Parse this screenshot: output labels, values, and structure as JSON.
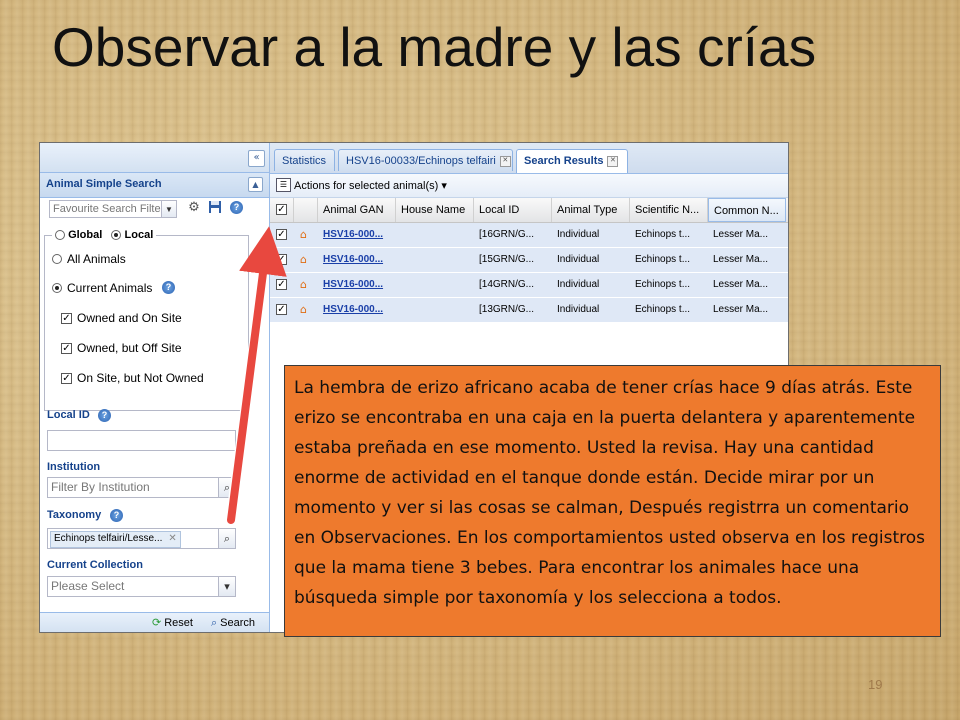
{
  "slide": {
    "title": "Observar a la madre y las crías",
    "page_number": "19",
    "callout_text": "La hembra de erizo africano acaba de tener crías hace 9 días atrás. Este erizo se encontraba en una caja en la puerta delantera y aparentemente estaba preñada en ese momento. Usted la revisa. Hay una cantidad enorme de actividad en el tanque donde están. Decide mirar por un momento y ver si las cosas se calman, Después registrra un comentario en Observaciones. En los comportamientos usted observa en los registros que la mama tiene 3 bebes. Para encontrar los animales hace una búsqueda simple por taxonomía y los selecciona a todos.",
    "colors": {
      "callout_bg": "#ee7a2d",
      "arrow": "#e8483f",
      "panel_header_text": "#15428b"
    }
  },
  "left_panel": {
    "collapse_icon": "double-chevron-left-icon",
    "header_title": "Animal Simple Search",
    "favourite_placeholder": "Favourite Search Filte",
    "scope": {
      "global_label": "Global",
      "local_label": "Local",
      "selected": "Local"
    },
    "options": {
      "all_animals": "All Animals",
      "current_animals": "Current Animals",
      "owned_on_site": "Owned and On Site",
      "owned_off_site": "Owned, but Off Site",
      "on_site_not_owned": "On Site, but Not Owned"
    },
    "local_id_label": "Local ID",
    "institution_label": "Institution",
    "institution_placeholder": "Filter By Institution",
    "taxonomy_label": "Taxonomy",
    "taxonomy_tag": "Echinops telfairi/Lesse...",
    "current_collection_label": "Current Collection",
    "current_collection_value": "Please Select",
    "reset_label": "Reset",
    "search_label": "Search"
  },
  "tabs": [
    {
      "label": "Statistics"
    },
    {
      "label": "HSV16-00033/Echinops telfairi"
    },
    {
      "label": "Search Results"
    }
  ],
  "toolbar": {
    "actions_label": "Actions for selected animal(s)"
  },
  "grid": {
    "columns": [
      "Animal GAN",
      "House Name",
      "Local ID",
      "Animal Type",
      "Scientific N...",
      "Common N..."
    ],
    "rows": [
      {
        "gan": "HSV16-000...",
        "house": "",
        "local_id": "[16GRN/G...",
        "type": "Individual",
        "scientific": "Echinops t...",
        "common": "Lesser Ma..."
      },
      {
        "gan": "HSV16-000...",
        "house": "",
        "local_id": "[15GRN/G...",
        "type": "Individual",
        "scientific": "Echinops t...",
        "common": "Lesser Ma..."
      },
      {
        "gan": "HSV16-000...",
        "house": "",
        "local_id": "[14GRN/G...",
        "type": "Individual",
        "scientific": "Echinops t...",
        "common": "Lesser Ma..."
      },
      {
        "gan": "HSV16-000...",
        "house": "",
        "local_id": "[13GRN/G...",
        "type": "Individual",
        "scientific": "Echinops t...",
        "common": "Lesser Ma..."
      }
    ]
  }
}
